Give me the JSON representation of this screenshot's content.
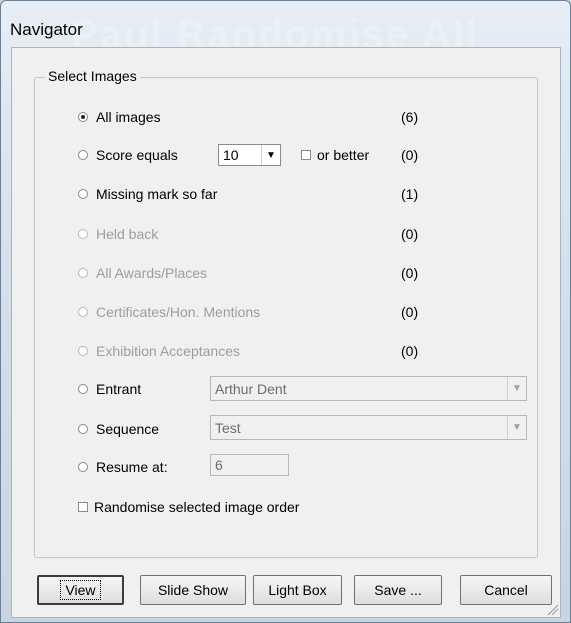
{
  "window": {
    "title": "Navigator",
    "watermark": "Paul Randomise All"
  },
  "group": {
    "label": "Select Images"
  },
  "options": [
    {
      "label": "All images",
      "count": "(6)",
      "selected": true,
      "enabled": true
    },
    {
      "label": "Score equals",
      "count": "(0)",
      "selected": false,
      "enabled": true
    },
    {
      "label": "Missing mark so far",
      "count": "(1)",
      "selected": false,
      "enabled": true
    },
    {
      "label": "Held back",
      "count": "(0)",
      "selected": false,
      "enabled": false
    },
    {
      "label": "All Awards/Places",
      "count": "(0)",
      "selected": false,
      "enabled": false
    },
    {
      "label": "Certificates/Hon. Mentions",
      "count": "(0)",
      "selected": false,
      "enabled": false
    },
    {
      "label": "Exhibition Acceptances",
      "count": "(0)",
      "selected": false,
      "enabled": false
    },
    {
      "label": "Entrant",
      "selected": false,
      "enabled": true
    },
    {
      "label": "Sequence",
      "selected": false,
      "enabled": true
    },
    {
      "label": "Resume at:",
      "selected": false,
      "enabled": true
    }
  ],
  "score_select": {
    "value": "10"
  },
  "or_better": {
    "label": "or better",
    "checked": false
  },
  "entrant_select": {
    "value": "Arthur Dent"
  },
  "sequence_select": {
    "value": "Test"
  },
  "resume_input": {
    "value": "6"
  },
  "randomise": {
    "label": "Randomise selected image order",
    "checked": false
  },
  "buttons": {
    "view": "View",
    "slideshow": "Slide Show",
    "lightbox": "Light Box",
    "save": "Save ...",
    "cancel": "Cancel"
  }
}
